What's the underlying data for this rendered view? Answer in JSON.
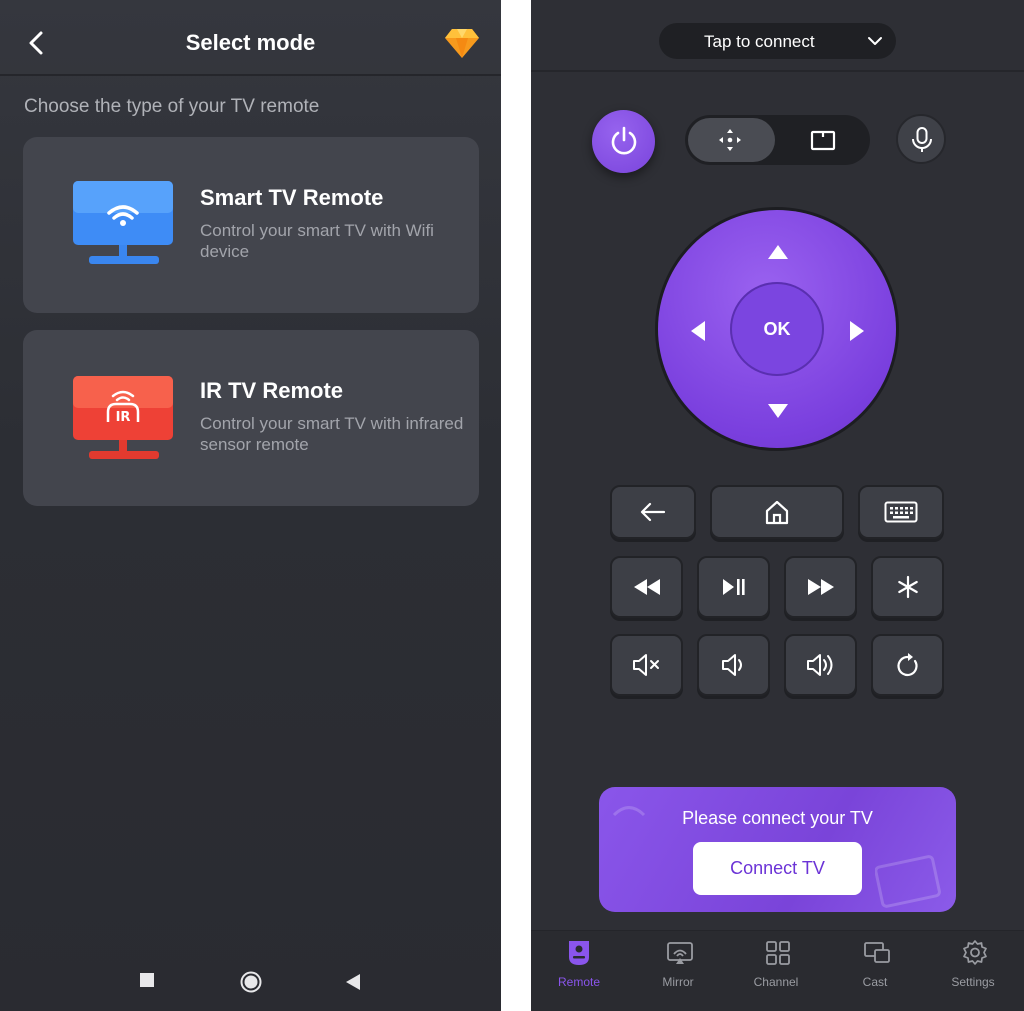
{
  "left_screen": {
    "header": {
      "title": "Select mode"
    },
    "subtitle": "Choose the type of your TV remote",
    "cards": [
      {
        "title": "Smart TV Remote",
        "description": "Control your smart TV with Wifi device",
        "icon": "wifi-tv-icon",
        "accent": "#3a8cf7"
      },
      {
        "title": "IR TV Remote",
        "description": "Control your smart TV with infrared sensor remote",
        "icon": "ir-tv-icon",
        "accent": "#f0473a"
      }
    ],
    "nav_icons": [
      "recents-square-icon",
      "home-circle-icon",
      "back-triangle-icon"
    ]
  },
  "right_screen": {
    "connect_pill": {
      "label": "Tap to connect"
    },
    "dpad": {
      "ok_label": "OK"
    },
    "banner": {
      "text": "Please connect your TV",
      "button": "Connect TV"
    },
    "tabs": [
      {
        "label": "Remote",
        "icon": "remote-icon",
        "active": true
      },
      {
        "label": "Mirror",
        "icon": "mirror-icon",
        "active": false
      },
      {
        "label": "Channel",
        "icon": "channel-grid-icon",
        "active": false
      },
      {
        "label": "Cast",
        "icon": "cast-icon",
        "active": false
      },
      {
        "label": "Settings",
        "icon": "gear-icon",
        "active": false
      }
    ],
    "accent_color": "#8a55ec"
  }
}
